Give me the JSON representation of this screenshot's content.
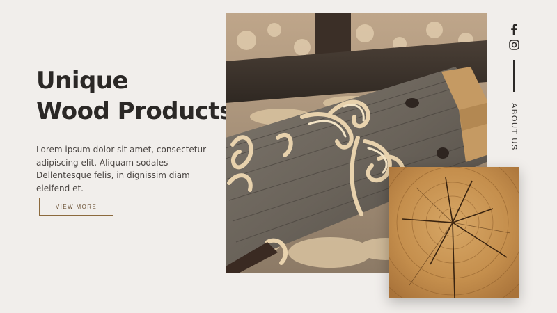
{
  "hero": {
    "title_line1": "Unique",
    "title_line2": "Wood Products",
    "description": "Lorem ipsum dolor sit amet, consectetur adipiscing elit. Aliquam sodales Dellentesque felis, in dignissim diam eleifend et.",
    "cta_label": "VIEW MORE"
  },
  "sidebar": {
    "social_icons": [
      "facebook-icon",
      "instagram-icon"
    ],
    "about_label": "ABOUT US"
  },
  "colors": {
    "background": "#f1eeeb",
    "heading": "#2b2826",
    "accent": "#8c6a3d"
  }
}
